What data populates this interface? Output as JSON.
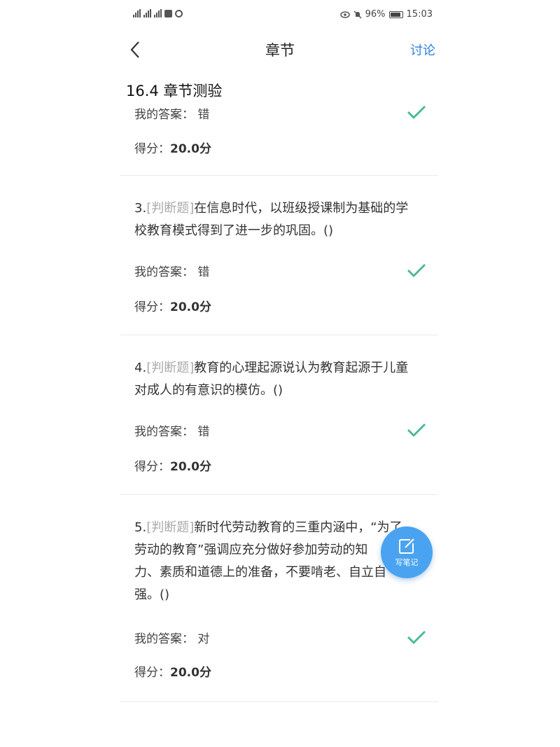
{
  "statusbar": {
    "battery": "96%",
    "time": "15:03"
  },
  "nav": {
    "title": "章节",
    "discuss": "讨论"
  },
  "section": {
    "title": "16.4 章节测验"
  },
  "labels": {
    "answer_prefix": "我的答案：",
    "score_prefix": "得分："
  },
  "questions": [
    {
      "answer": "错",
      "score": "20.0分"
    },
    {
      "number": "3.",
      "tag": "[判断题]",
      "line1": "在信息时代，以班级授课制为基础的学",
      "line2": "校教育模式得到了进一步的巩固。()",
      "answer": "错",
      "score": "20.0分"
    },
    {
      "number": "4.",
      "tag": "[判断题]",
      "line1": "教育的心理起源说认为教育起源于儿童",
      "line2": "对成人的有意识的模仿。()",
      "answer": "错",
      "score": "20.0分"
    },
    {
      "number": "5.",
      "tag": "[判断题]",
      "line1": "新时代劳动教育的三重内涵中，“为了",
      "line2": "劳动的教育”强调应充分做好参加劳动的知",
      "line3": "力、素质和道德上的准备，不要啃老、自立自",
      "line4": "强。()",
      "answer": "对",
      "score": "20.0分"
    }
  ],
  "fab": {
    "label": "写笔记"
  },
  "colors": {
    "accent": "#2b7fe0",
    "check": "#46b89a",
    "fab": "#4aa3f0"
  }
}
